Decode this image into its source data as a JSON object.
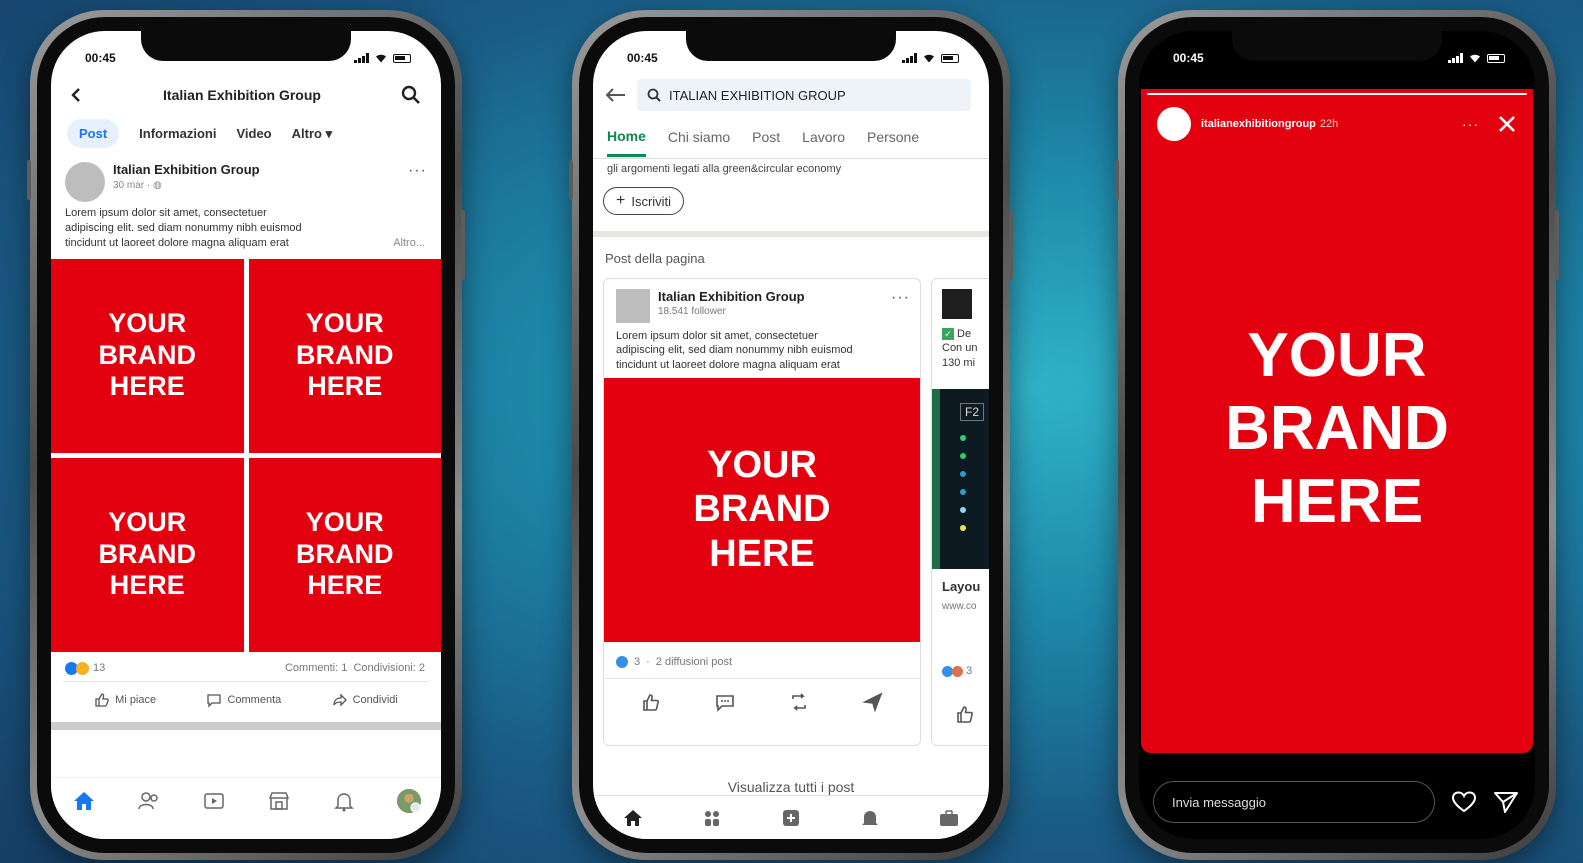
{
  "colors": {
    "brand_red": "#e3000f",
    "fb_blue": "#1877f2",
    "li_green": "#0a8a4d"
  },
  "brand_text": [
    "YOUR",
    "BRAND",
    "HERE"
  ],
  "facebook": {
    "status_time": "00:45",
    "header_title": "Italian Exhibition Group",
    "tabs": [
      "Post",
      "Informazioni",
      "Video",
      "Altro ▾"
    ],
    "post": {
      "author": "Italian Exhibition Group",
      "meta": "30 mar · ◍",
      "text_lines": [
        "Lorem ipsum dolor sit amet, consectetuer",
        "adipiscing elit. sed diam nonummy nibh euismod",
        "tincidunt ut laoreet dolore magna aliquam erat"
      ],
      "more_link": "Altro...",
      "reaction_count": "13",
      "comments": "Commenti: 1",
      "shares": "Condivisioni: 2",
      "actions": [
        "Mi piace",
        "Commenta",
        "Condividi"
      ]
    },
    "bottom_nav_icons": [
      "home-icon",
      "friends-icon",
      "watch-icon",
      "marketplace-icon",
      "bell-icon",
      "profile-icon"
    ]
  },
  "linkedin": {
    "status_time": "00:45",
    "search_value": "ITALIAN EXHIBITION GROUP",
    "tabs": [
      "Home",
      "Chi siamo",
      "Post",
      "Lavoro",
      "Persone"
    ],
    "description": "gli argomenti legati alla green&circular economy",
    "follow_label": "Iscriviti",
    "section_title": "Post della pagina",
    "post": {
      "author": "Italian Exhibition Group",
      "followers": "18.541 follower",
      "text_lines": [
        "Lorem ipsum dolor sit amet, consectetuer",
        "adipiscing elit, sed diam nonummy nibh euismod",
        "tincidunt ut laoreet dolore magna aliquam erat"
      ],
      "reactions": "3",
      "reposts": "2 diffusioni post"
    },
    "second_card": {
      "lines": [
        "De",
        "Con un",
        "130 mi"
      ],
      "tag": "F2",
      "title": "Layou",
      "link": "www.co",
      "count": "3"
    },
    "see_all": "Visualizza tutti i post",
    "bottom_nav_icons": [
      "home-icon",
      "network-icon",
      "post-icon",
      "notifications-icon",
      "jobs-icon"
    ]
  },
  "instagram": {
    "status_time": "00:45",
    "username": "italianexhibitiongroup",
    "time_ago": "22h",
    "more": "···",
    "message_placeholder": "Invia messaggio"
  }
}
